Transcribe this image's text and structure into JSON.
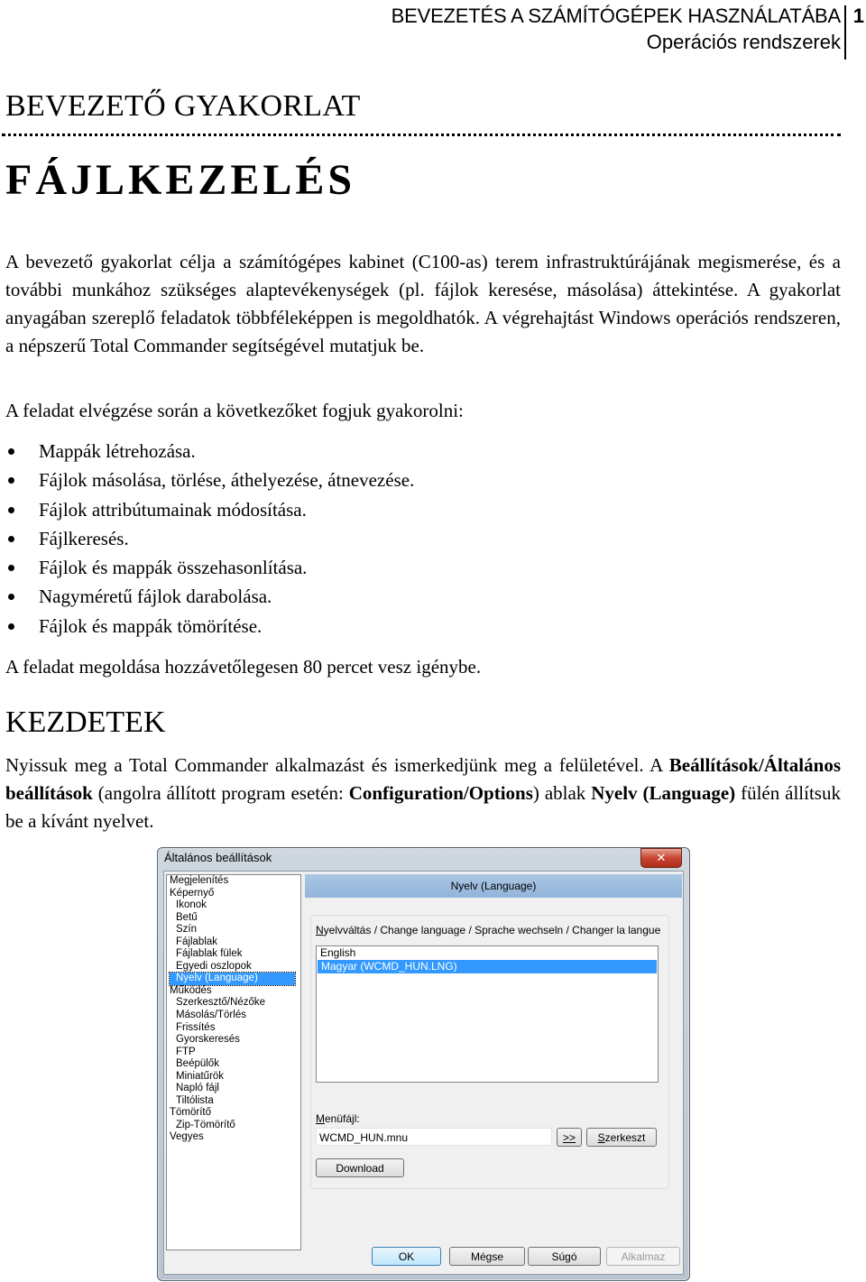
{
  "running_header": {
    "course_title": "BEVEZETÉS A SZÁMÍTÓGÉPEK HASZNÁLATÁBA",
    "subtitle": "Operációs rendszerek",
    "page_number": "1"
  },
  "section_heading": "BEVEZETŐ GYAKORLAT",
  "title": "FÁJLKEZELÉS",
  "intro_paragraph": "A bevezető gyakorlat célja a számítógépes kabinet (C100-as) terem infrastruktúrájának megismerése, és a további munkához szükséges alaptevékenységek (pl. fájlok keresése, másolása) áttekintése. A gyakorlat anyagában szereplő feladatok többféleképpen is  megoldhatók. A végrehajtást Windows operációs rendszeren, a népszerű Total Commander segítségével mutatjuk be.",
  "list_intro": "A feladat elvégzése során a következőket fogjuk gyakorolni:",
  "bullets": [
    "Mappák létrehozása.",
    "Fájlok másolása, törlése, áthelyezése, átnevezése.",
    "Fájlok attribútumainak módosítása.",
    "Fájlkeresés.",
    "Fájlok és mappák összehasonlítása.",
    "Nagyméretű fájlok darabolása.",
    "Fájlok és mappák tömörítése."
  ],
  "duration_note": "A feladat megoldása hozzávetőlegesen 80 percet vesz igénybe.",
  "subheading": "KEZDETEK",
  "start_paragraph": {
    "part1": "Nyissuk meg a Total Commander alkalmazást és ismerkedjünk meg a felületével. A ",
    "bold1": "Beállítások/Általános beállítások",
    "part2": " (angolra állított program esetén: ",
    "bold2": "Configuration/Options",
    "part3": ") ablak ",
    "bold3": "Nyelv (Language)",
    "part4": " fülén állítsuk be a kívánt nyelvet."
  },
  "dialog": {
    "title": "Általános beállítások",
    "close_icon": "close-icon",
    "tree_items": [
      {
        "label": "Megjelenítés",
        "level": 0
      },
      {
        "label": "Képernyő",
        "level": 0
      },
      {
        "label": "Ikonok",
        "level": 1
      },
      {
        "label": "Betű",
        "level": 1
      },
      {
        "label": "Szín",
        "level": 1
      },
      {
        "label": "Fájlablak",
        "level": 1
      },
      {
        "label": "Fájlablak fülek",
        "level": 1
      },
      {
        "label": "Egyedi oszlopok",
        "level": 1
      },
      {
        "label": "Nyelv (Language)",
        "level": 1,
        "selected": true
      },
      {
        "label": "Működés",
        "level": 0
      },
      {
        "label": "Szerkesztő/Nézőke",
        "level": 1
      },
      {
        "label": "Másolás/Törlés",
        "level": 1
      },
      {
        "label": "Frissítés",
        "level": 1
      },
      {
        "label": "Gyorskeresés",
        "level": 1
      },
      {
        "label": "FTP",
        "level": 1
      },
      {
        "label": "Beépülők",
        "level": 1
      },
      {
        "label": "Miniatűrök",
        "level": 1
      },
      {
        "label": "Napló fájl",
        "level": 1
      },
      {
        "label": "Tiltólista",
        "level": 1
      },
      {
        "label": "Tömörítő",
        "level": 0
      },
      {
        "label": "Zip-Tömörítő",
        "level": 1
      },
      {
        "label": "Vegyes",
        "level": 0
      }
    ],
    "panel_title": "Nyelv (Language)",
    "language_label_first": "N",
    "language_label_rest": "yelvváltás / Change language / Sprache wechseln / Changer la langue",
    "languages": [
      {
        "label": "English",
        "selected": false
      },
      {
        "label": "Magyar (WCMD_HUN.LNG)",
        "selected": true
      }
    ],
    "menu_file_label_first": "M",
    "menu_file_label_rest": "enüfájl:",
    "menu_file_value": "WCMD_HUN.mnu",
    "browse_button": ">>",
    "edit_button_first": "S",
    "edit_button_rest": "zerkeszt",
    "download_button": "Download",
    "ok_button": "OK",
    "cancel_button": "Mégse",
    "help_button": "Súgó",
    "apply_button": "Alkalmaz"
  }
}
